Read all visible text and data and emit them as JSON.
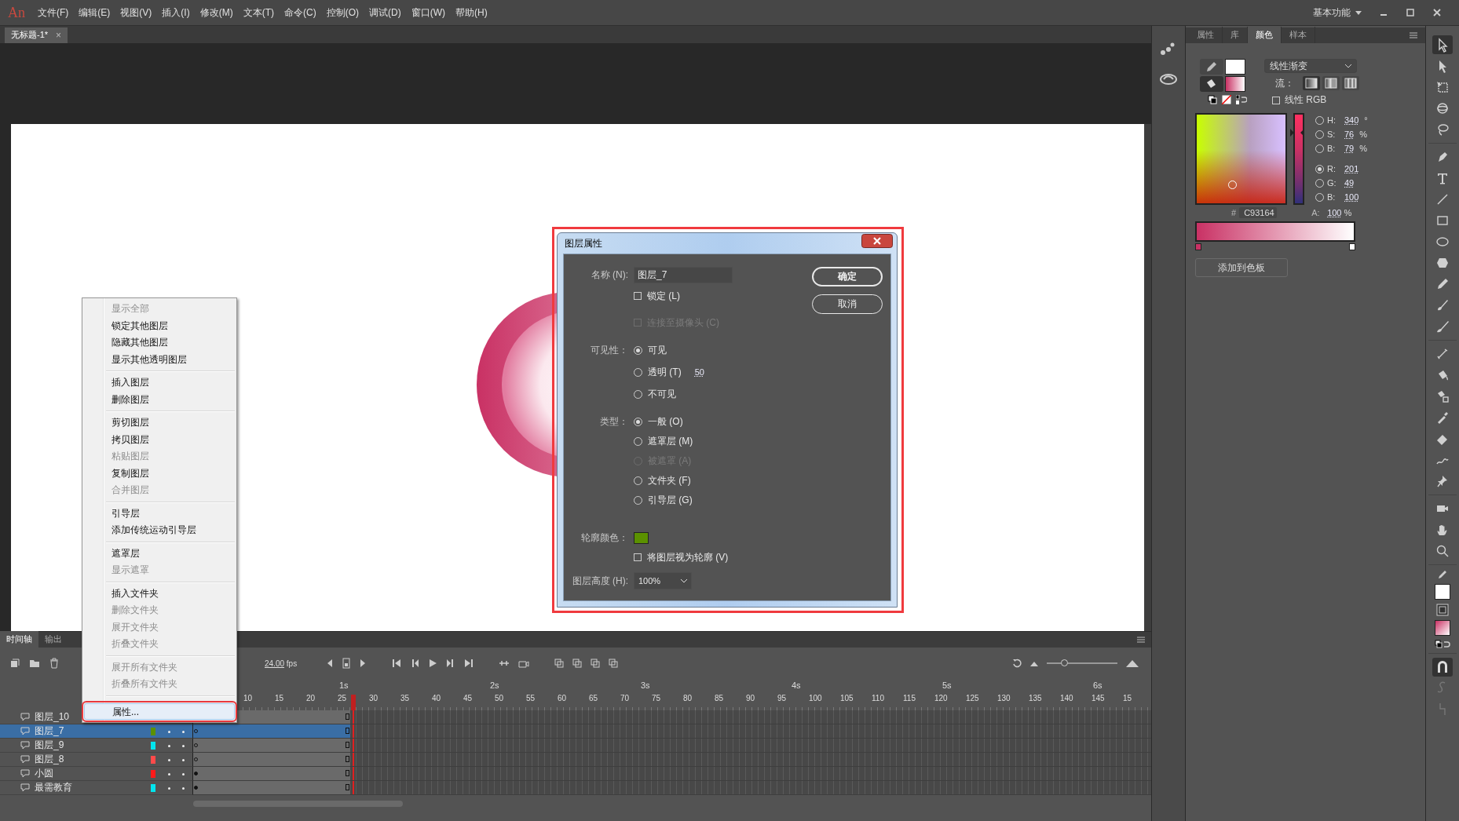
{
  "menu_bar": {
    "logo": "An",
    "items": [
      "文件(F)",
      "编辑(E)",
      "视图(V)",
      "插入(I)",
      "修改(M)",
      "文本(T)",
      "命令(C)",
      "控制(O)",
      "调试(D)",
      "窗口(W)",
      "帮助(H)"
    ],
    "workspace": "基本功能"
  },
  "document_tabs": [
    {
      "title": "无标题-1*",
      "close": "×",
      "selected": true
    }
  ],
  "context_menu": {
    "groups": [
      {
        "items": [
          {
            "label": "显示全部",
            "disabled": true,
            "selected": false
          },
          {
            "label": "锁定其他图层",
            "disabled": false,
            "selected": false
          },
          {
            "label": "隐藏其他图层",
            "disabled": false,
            "selected": false
          },
          {
            "label": "显示其他透明图层",
            "disabled": false,
            "selected": false
          }
        ]
      },
      {
        "items": [
          {
            "label": "插入图层",
            "disabled": false,
            "selected": false
          },
          {
            "label": "删除图层",
            "disabled": false,
            "selected": false
          }
        ]
      },
      {
        "items": [
          {
            "label": "剪切图层",
            "disabled": false,
            "selected": false
          },
          {
            "label": "拷贝图层",
            "disabled": false,
            "selected": false
          },
          {
            "label": "粘贴图层",
            "disabled": true,
            "selected": false
          },
          {
            "label": "复制图层",
            "disabled": false,
            "selected": false
          },
          {
            "label": "合并图层",
            "disabled": true,
            "selected": false
          }
        ]
      },
      {
        "items": [
          {
            "label": "引导层",
            "disabled": false,
            "selected": false
          },
          {
            "label": "添加传统运动引导层",
            "disabled": false,
            "selected": false
          }
        ]
      },
      {
        "items": [
          {
            "label": "遮罩层",
            "disabled": false,
            "selected": false
          },
          {
            "label": "显示遮罩",
            "disabled": true,
            "selected": false
          }
        ]
      },
      {
        "items": [
          {
            "label": "插入文件夹",
            "disabled": false,
            "selected": false
          },
          {
            "label": "删除文件夹",
            "disabled": true,
            "selected": false
          },
          {
            "label": "展开文件夹",
            "disabled": true,
            "selected": false
          },
          {
            "label": "折叠文件夹",
            "disabled": true,
            "selected": false
          }
        ]
      },
      {
        "items": [
          {
            "label": "展开所有文件夹",
            "disabled": true,
            "selected": false
          },
          {
            "label": "折叠所有文件夹",
            "disabled": true,
            "selected": false
          }
        ]
      },
      {
        "items": [
          {
            "label": "属性...",
            "disabled": false,
            "selected": true
          }
        ]
      }
    ]
  },
  "dialog": {
    "title": "图层属性",
    "name": {
      "label": "名称 (N):",
      "value": "图层_7"
    },
    "lock": {
      "label": "锁定 (L)",
      "checked": false
    },
    "camera": {
      "label": "连接至摄像头 (C)",
      "checked": false,
      "disabled": true
    },
    "visibility": {
      "label": "可见性：",
      "options": [
        {
          "label": "可见",
          "selected": true
        },
        {
          "label": "透明 (T)",
          "selected": false,
          "value": "50"
        },
        {
          "label": "不可见",
          "selected": false
        }
      ]
    },
    "type": {
      "label": "类型：",
      "options": [
        {
          "label": "一般 (O)",
          "selected": true,
          "disabled": false
        },
        {
          "label": "遮罩层 (M)",
          "selected": false,
          "disabled": false
        },
        {
          "label": "被遮罩 (A)",
          "selected": false,
          "disabled": true
        },
        {
          "label": "文件夹 (F)",
          "selected": false,
          "disabled": false
        },
        {
          "label": "引导层 (G)",
          "selected": false,
          "disabled": false
        }
      ]
    },
    "outline_color": {
      "label": "轮廓颜色：",
      "color": "#5b9100"
    },
    "view_as_outline": {
      "label": "将图层视为轮廓 (V)",
      "checked": false
    },
    "layer_height": {
      "label": "图层高度 (H):",
      "value": "100%"
    },
    "buttons": [
      {
        "label": "确定",
        "kind": "default"
      },
      {
        "label": "取消",
        "kind": "normal"
      }
    ]
  },
  "timeline": {
    "zoom_slider": {
      "level": 0.25
    },
    "tabs": [
      {
        "label": "时间轴",
        "selected": true
      },
      {
        "label": "输出",
        "selected": false
      }
    ],
    "fps": "24.00",
    "fps_unit": "fps",
    "seconds": [
      "1s",
      "2s",
      "3s",
      "4s",
      "5s",
      "6s"
    ],
    "frame_numbers": [
      "10",
      "15",
      "20",
      "25",
      "30",
      "35",
      "40",
      "45",
      "50",
      "55",
      "60",
      "65",
      "70",
      "75",
      "80",
      "85",
      "90",
      "95",
      "100",
      "105",
      "110",
      "115",
      "120",
      "125",
      "130",
      "135",
      "140",
      "145",
      "15"
    ],
    "layers": [
      {
        "name": "图层_10",
        "selected": false
      },
      {
        "name": "图层_7",
        "selected": true,
        "color": "#5b9100",
        "keyframe_filled": false
      },
      {
        "name": "图层_9",
        "selected": false,
        "color": "#00e5ee",
        "keyframe_filled": false
      },
      {
        "name": "图层_8",
        "selected": false,
        "color": "#ff4a4a",
        "keyframe_filled": false
      },
      {
        "name": "小圆",
        "selected": false,
        "color": "#ff1a1a",
        "keyframe_filled": true
      },
      {
        "name": "最需教育",
        "selected": false,
        "color": "#00e5ee",
        "keyframe_filled": true
      }
    ]
  },
  "color_panel": {
    "tabs": [
      {
        "label": "属性",
        "selected": false
      },
      {
        "label": "库",
        "selected": false
      },
      {
        "label": "颜色",
        "selected": true
      },
      {
        "label": "样本",
        "selected": false
      }
    ],
    "fill_type": "线性渐变",
    "flow_label": "流：",
    "linear_rgb": {
      "label": "线性 RGB",
      "checked": false
    },
    "channels": [
      {
        "label": "H:",
        "value": "340",
        "unit": "°",
        "selected": false
      },
      {
        "label": "S:",
        "value": "76",
        "unit": "%",
        "selected": false
      },
      {
        "label": "B:",
        "value": "79",
        "unit": "%",
        "selected": false
      },
      {
        "label": "R:",
        "value": "201",
        "selected": true
      },
      {
        "label": "G:",
        "value": "49",
        "selected": false
      },
      {
        "label": "B:",
        "value": "100",
        "selected": false
      }
    ],
    "hex_label": "#",
    "hex": "C93164",
    "alpha_label": "A:",
    "alpha": "100",
    "alpha_unit": "%",
    "gradient_stops": [
      {
        "color": "#c93164"
      },
      {
        "color": "#ffffff"
      }
    ],
    "add_button": "添加到色板"
  }
}
